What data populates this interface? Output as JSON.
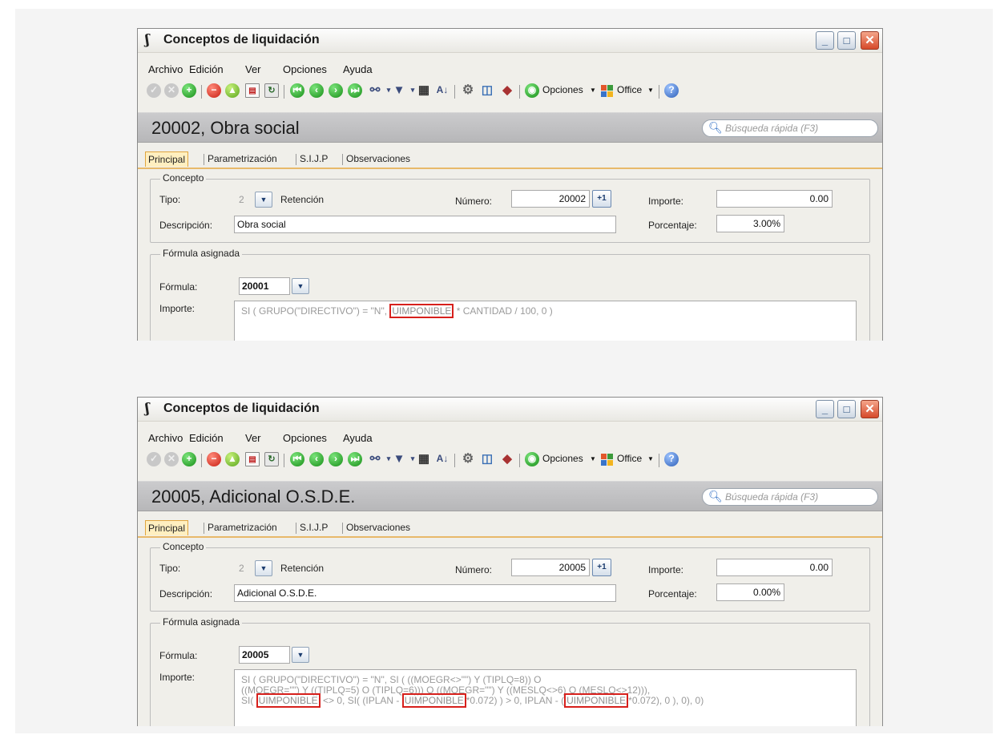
{
  "windows": [
    {
      "title": "Conceptos de liquidación",
      "menu": [
        "Archivo",
        "Edición",
        "Ver",
        "Opciones",
        "Ayuda"
      ],
      "toolbar": {
        "opciones_label": "Opciones",
        "office_label": "Office"
      },
      "record_title": "20002, Obra social",
      "search_placeholder": "Búsqueda rápida (F3)",
      "tabs": [
        "Principal",
        "Parametrización",
        "S.I.J.P",
        "Observaciones"
      ],
      "concepto": {
        "legend": "Concepto",
        "tipo_label": "Tipo:",
        "tipo_value": "2",
        "tipo_text": "Retención",
        "numero_label": "Número:",
        "numero_value": "20002",
        "importe_label": "Importe:",
        "importe_value": "0.00",
        "descripcion_label": "Descripción:",
        "descripcion_value": "Obra social",
        "porcentaje_label": "Porcentaje:",
        "porcentaje_value": "3.00%"
      },
      "formula": {
        "legend": "Fórmula asignada",
        "formula_label": "Fórmula:",
        "formula_value": "20001",
        "importe_label": "Importe:",
        "parts": [
          "SI ( GRUPO(\"DIRECTIVO\") = \"N\", ",
          "UIMPONIBLE",
          " * CANTIDAD / 100, 0 )"
        ]
      }
    },
    {
      "title": "Conceptos de liquidación",
      "menu": [
        "Archivo",
        "Edición",
        "Ver",
        "Opciones",
        "Ayuda"
      ],
      "toolbar": {
        "opciones_label": "Opciones",
        "office_label": "Office"
      },
      "record_title": "20005, Adicional O.S.D.E.",
      "search_placeholder": "Búsqueda rápida (F3)",
      "tabs": [
        "Principal",
        "Parametrización",
        "S.I.J.P",
        "Observaciones"
      ],
      "concepto": {
        "legend": "Concepto",
        "tipo_label": "Tipo:",
        "tipo_value": "2",
        "tipo_text": "Retención",
        "numero_label": "Número:",
        "numero_value": "20005",
        "importe_label": "Importe:",
        "importe_value": "0.00",
        "descripcion_label": "Descripción:",
        "descripcion_value": "Adicional O.S.D.E.",
        "porcentaje_label": "Porcentaje:",
        "porcentaje_value": "0.00%"
      },
      "formula": {
        "legend": "Fórmula asignada",
        "formula_label": "Fórmula:",
        "formula_value": "20005",
        "importe_label": "Importe:",
        "line1": "SI ( GRUPO(\"DIRECTIVO\") = \"N\", SI ( ((MOEGR<>\"\") Y (TIPLQ=8)) O",
        "line2": "((MOEGR=\"\") Y ((TIPLQ=5) O (TIPLQ=6))) O ((MOEGR=\"\") Y ((MESLQ<>6) O (MESLQ<>12))),",
        "line3_parts": [
          "SI( ",
          "UIMPONIBLE",
          " <> 0, SI( (IPLAN - ",
          "UIMPONIBLE",
          "*0.072) ) > 0, IPLAN - (",
          "UIMPONIBLE",
          "*0.072), 0 ), 0), 0)"
        ]
      }
    }
  ],
  "colors": {
    "highlight": "#d7201c",
    "tab_active": "#ffefc0",
    "header_bg": "#c2c2c4"
  },
  "icons": [
    "check-icon",
    "cancel-icon",
    "add-icon",
    "delete-icon",
    "save-icon",
    "clipboard-icon",
    "refresh-icon",
    "first-icon",
    "previous-icon",
    "next-icon",
    "last-icon",
    "binoculars-icon",
    "filter-icon",
    "grid-icon",
    "sort-icon",
    "gear-icon",
    "preview-icon",
    "box-icon",
    "options-icon",
    "office-icon",
    "help-icon"
  ]
}
